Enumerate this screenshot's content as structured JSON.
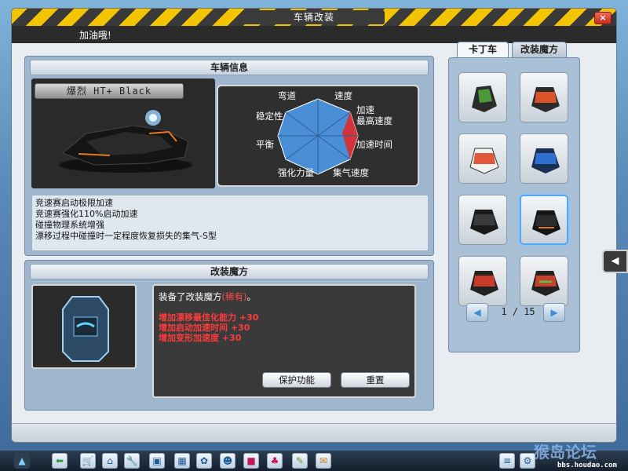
{
  "window": {
    "title": "车辆改装",
    "close_label": "×"
  },
  "message": "加油哦!",
  "car_info": {
    "header": "车辆信息",
    "car_name": "爆烈 HT+ Black",
    "radar": {
      "labels": {
        "top_left": "弯道",
        "top_right": "速度",
        "right_upper": "加速",
        "right_upper2": "最高速度",
        "left_upper": "稳定性",
        "left_lower": "平衡",
        "right_lower": "加速时间",
        "bottom_left": "强化力量",
        "bottom_right": "集气速度"
      }
    },
    "description": [
      "竞速赛启动极限加速",
      "竞速赛强化110%启动加速",
      "碰撞物理系统增强",
      "漂移过程中碰撞时一定程度恢复损失的集气-S型"
    ]
  },
  "mod": {
    "header": "改装魔方",
    "equipped_prefix": "装备了改装魔方",
    "equipped_rarity": "(稀有)",
    "equipped_suffix": "。",
    "stats": [
      "增加漂移最佳化能力 +30",
      "增加启动加速时间 +30",
      "增加变形加速度 +30"
    ],
    "protect_button": "保护功能",
    "reset_button": "重置"
  },
  "tabs": [
    {
      "label": "卡丁车",
      "active": true
    },
    {
      "label": "改装魔方",
      "active": false
    }
  ],
  "grid": {
    "cars": [
      {
        "name": "kart-green",
        "color": "#4a9a3a"
      },
      {
        "name": "kart-red-orange",
        "color": "#d9532a"
      },
      {
        "name": "kart-red-white",
        "color": "#e0573a"
      },
      {
        "name": "kart-blue",
        "color": "#2f6fd0"
      },
      {
        "name": "kart-black",
        "color": "#3a3a3a"
      },
      {
        "name": "kart-black-selected",
        "color": "#2c2c2c"
      },
      {
        "name": "kart-red-black",
        "color": "#c63b2a"
      },
      {
        "name": "kart-red-green",
        "color": "#c8402c"
      }
    ],
    "page_text": "1 / 15"
  },
  "watermark": {
    "text": "猴岛论坛",
    "url": "bbs.houdao.com"
  },
  "colors": {
    "radar_fill": "#4a8ed6",
    "radar_accent": "#e02a2a",
    "stat_red": "#ff3b3b"
  }
}
